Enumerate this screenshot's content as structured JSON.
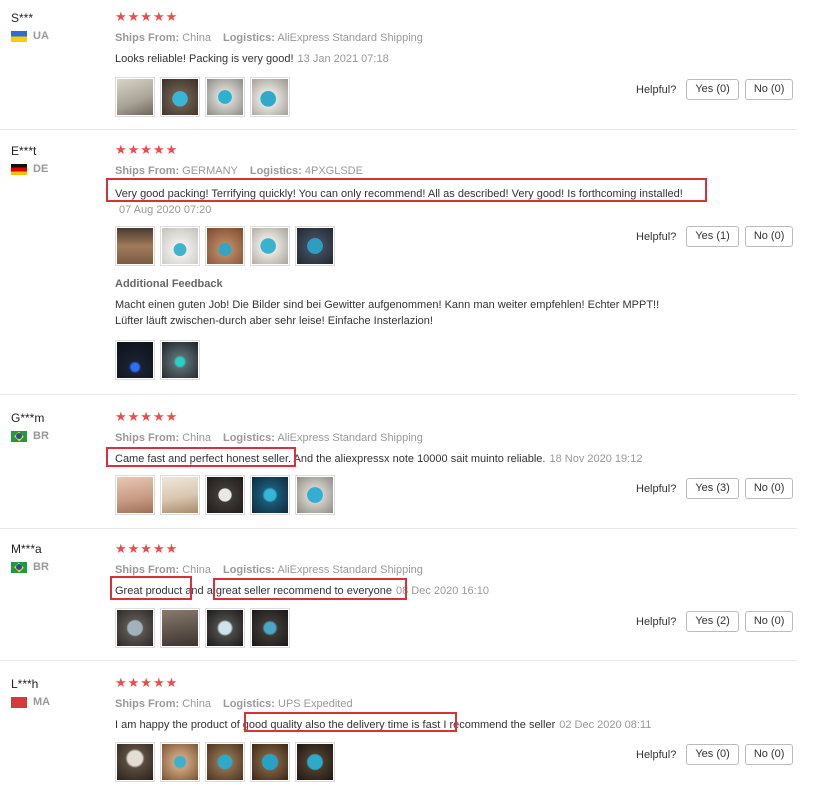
{
  "helpful_label": "Helpful?",
  "ships_from_label": "Ships From:",
  "logistics_label": "Logistics:",
  "reviews": [
    {
      "user": "S***",
      "country": "UA",
      "stars": "★★★★★",
      "ships_from": "China",
      "logistics": "AliExpress Standard Shipping",
      "text": "Looks reliable! Packing is very good!",
      "date": "13 Jan 2021 07:18",
      "yes": "Yes (0)",
      "no": "No (0)"
    },
    {
      "user": "E***t",
      "country": "DE",
      "stars": "★★★★★",
      "ships_from": "GERMANY",
      "logistics": "4PXGLSDE",
      "text": "Very good packing! Terrifying quickly! You can only recommend! All as described! Very good! Is forthcoming installed!",
      "date": "07 Aug 2020 07:20",
      "yes": "Yes (1)",
      "no": "No (0)",
      "additional_title": "Additional Feedback",
      "additional_line1": "Macht einen guten Job! Die Bilder sind bei Gewitter aufgenommen! Kann man weiter empfehlen! Echter MPPT!!",
      "additional_line2": "Lüfter läuft zwischen-durch aber sehr leise! Einfache Insterlazion!"
    },
    {
      "user": "G***m",
      "country": "BR",
      "stars": "★★★★★",
      "ships_from": "China",
      "logistics": "AliExpress Standard Shipping",
      "text": "Came fast and perfect honest seller. And the aliexpressx note 10000 sait muinto reliable.",
      "date": "18 Nov 2020 19:12",
      "yes": "Yes (3)",
      "no": "No (0)"
    },
    {
      "user": "M***a",
      "country": "BR",
      "stars": "★★★★★",
      "ships_from": "China",
      "logistics": "AliExpress Standard Shipping",
      "text": "Great product and a great seller recommend to everyone",
      "date": "08 Dec 2020 16:10",
      "yes": "Yes (2)",
      "no": "No (0)"
    },
    {
      "user": "L***h",
      "country": "MA",
      "stars": "★★★★★",
      "ships_from": "China",
      "logistics": "UPS Expedited",
      "text": "I am happy the product of good quality also the delivery time is fast I recommend the seller",
      "date": "02 Dec 2020 08:11",
      "yes": "Yes (0)",
      "no": "No (0)"
    }
  ],
  "colors": {
    "star": "#f04b4b",
    "highlight": "#d9303a",
    "muted": "#999999"
  }
}
